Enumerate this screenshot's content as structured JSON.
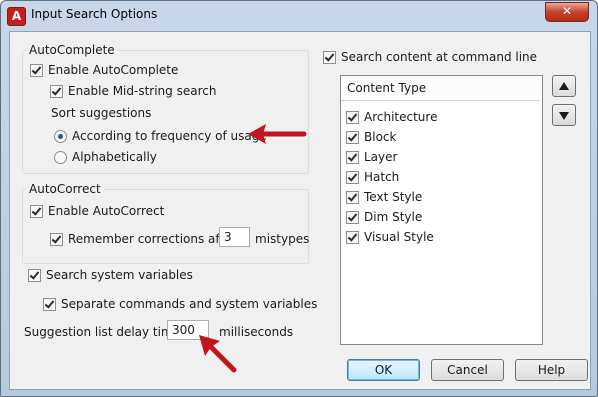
{
  "window": {
    "title": "Input Search Options",
    "close_label": "✕"
  },
  "autocomplete": {
    "legend": "AutoComplete",
    "enable_label": "Enable AutoComplete",
    "enable_checked": true,
    "midstring_label": "Enable Mid-string search",
    "midstring_checked": true,
    "sort_label": "Sort suggestions",
    "sort_options": [
      {
        "label": "According to frequency of usage",
        "selected": true
      },
      {
        "label": "Alphabetically",
        "selected": false
      }
    ]
  },
  "autocorrect": {
    "legend": "AutoCorrect",
    "enable_label": "Enable AutoCorrect",
    "enable_checked": true,
    "remember_label": "Remember corrections after",
    "remember_checked": true,
    "remember_value": "3",
    "remember_suffix": "mistypes"
  },
  "system_vars": {
    "search_label": "Search system variables",
    "search_checked": true,
    "separate_label": "Separate commands and system variables",
    "separate_checked": true
  },
  "delay": {
    "label": "Suggestion list delay time",
    "value": "300",
    "suffix": "milliseconds"
  },
  "content_search": {
    "label": "Search content at command line",
    "checked": true,
    "header": "Content Type",
    "items": [
      {
        "label": "Architecture",
        "checked": true
      },
      {
        "label": "Block",
        "checked": true
      },
      {
        "label": "Layer",
        "checked": true
      },
      {
        "label": "Hatch",
        "checked": true
      },
      {
        "label": "Text Style",
        "checked": true
      },
      {
        "label": "Dim Style",
        "checked": true
      },
      {
        "label": "Visual Style",
        "checked": true
      }
    ]
  },
  "buttons": {
    "ok": "OK",
    "cancel": "Cancel",
    "help": "Help"
  },
  "colors": {
    "annotation_arrow": "#c0161b",
    "titlebar": "#c8d7e8"
  },
  "icons": {
    "app": "autocad-icon",
    "close": "close-icon",
    "move_up": "arrow-up-icon",
    "move_down": "arrow-down-icon"
  }
}
